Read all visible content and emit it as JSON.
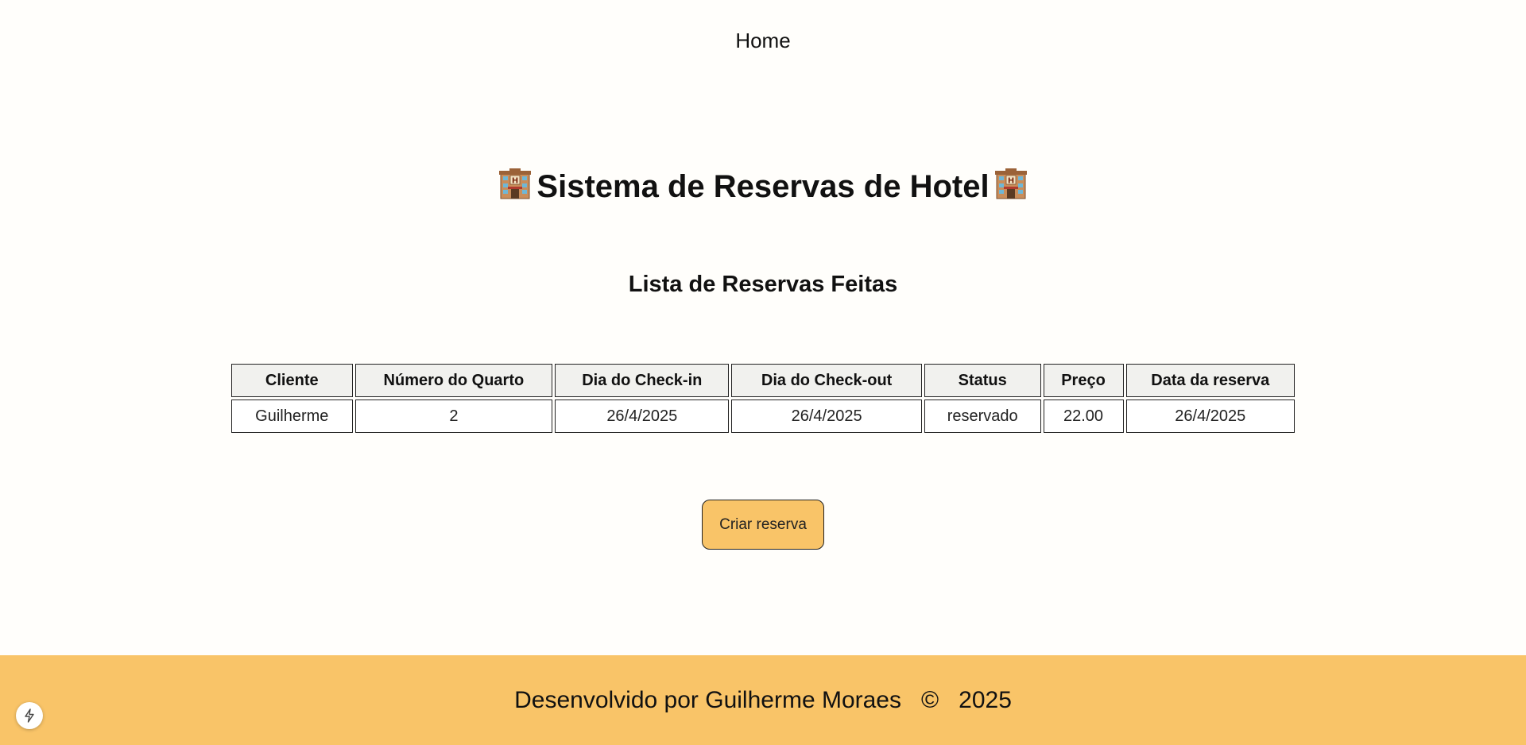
{
  "nav": {
    "home_label": "Home"
  },
  "header": {
    "title": "Sistema de Reservas de Hotel",
    "icon": "hotel-icon"
  },
  "main": {
    "subtitle": "Lista de Reservas Feitas",
    "table": {
      "columns": [
        "Cliente",
        "Número do Quarto",
        "Dia do Check-in",
        "Dia do Check-out",
        "Status",
        "Preço",
        "Data da reserva"
      ],
      "rows": [
        [
          "Guilherme",
          "2",
          "26/4/2025",
          "26/4/2025",
          "reservado",
          "22.00",
          "26/4/2025"
        ]
      ]
    },
    "create_button_label": "Criar reserva"
  },
  "footer": {
    "text": "Desenvolvido por Guilherme Moraes",
    "copyright_symbol": "©",
    "year": "2025"
  },
  "colors": {
    "accent": "#f9c468",
    "background": "#fffefb",
    "header_cell": "#f1f1ee"
  },
  "dev_indicator_icon": "bolt-icon"
}
